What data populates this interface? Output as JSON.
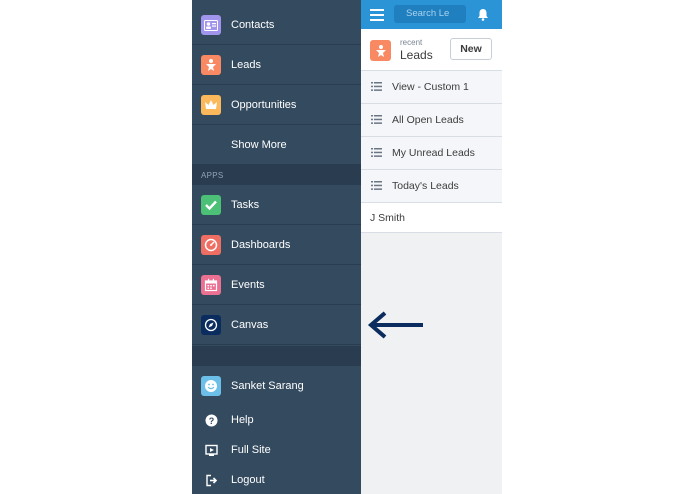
{
  "sidebar": {
    "items": [
      {
        "label": "Contacts",
        "icon": "contact-card-icon",
        "color": "#a094ed"
      },
      {
        "label": "Leads",
        "icon": "lead-star-icon",
        "color": "#f88962"
      },
      {
        "label": "Opportunities",
        "icon": "crown-icon",
        "color": "#fcb95b"
      },
      {
        "label": "Show More"
      }
    ],
    "apps_header": "APPS",
    "apps": [
      {
        "label": "Tasks",
        "icon": "checkmark-icon",
        "color": "#4bc076"
      },
      {
        "label": "Dashboards",
        "icon": "gauge-icon",
        "color": "#ef6e64"
      },
      {
        "label": "Events",
        "icon": "calendar-icon",
        "color": "#eb7092"
      },
      {
        "label": "Canvas",
        "icon": "compass-icon",
        "color": "#0b2c5e"
      }
    ],
    "user": {
      "name": "Sanket Sarang",
      "icon": "smiley-avatar-icon",
      "color": "#6cbfe8"
    },
    "utility": [
      {
        "label": "Help",
        "icon": "help-icon"
      },
      {
        "label": "Full Site",
        "icon": "full-site-icon"
      },
      {
        "label": "Logout",
        "icon": "logout-icon"
      }
    ]
  },
  "main": {
    "search_placeholder": "Search Le",
    "header": {
      "overline": "recent",
      "title": "Leads",
      "new_label": "New"
    },
    "list_views": [
      "View - Custom 1",
      "All Open Leads",
      "My Unread Leads",
      "Today's Leads"
    ],
    "recent_item": "J Smith"
  },
  "colors": {
    "sidebar": "#344a5f",
    "topbar": "#2a94d6",
    "arrow": "#0b2c5e"
  }
}
